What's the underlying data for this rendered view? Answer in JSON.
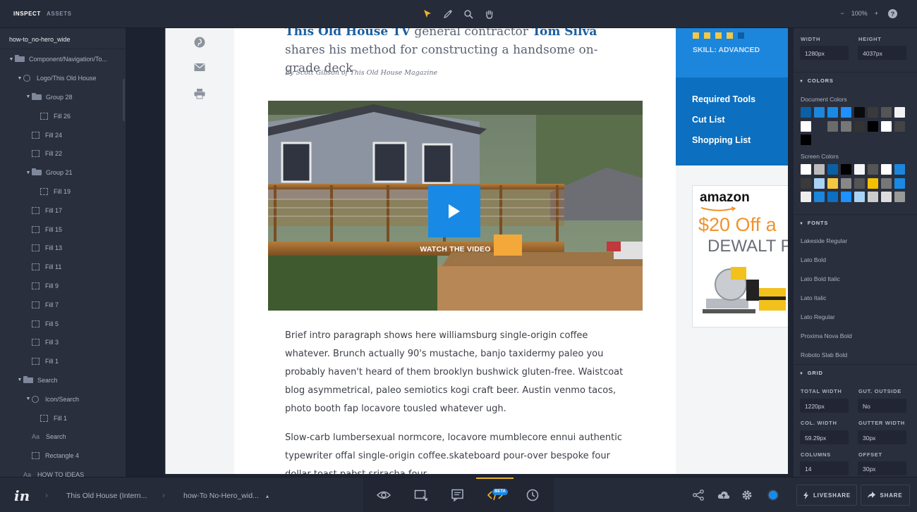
{
  "topbar": {
    "tab_inspect": "INSPECT",
    "tab_assets": "ASSETS",
    "zoom_minus": "−",
    "zoom_level": "100%",
    "zoom_plus": "+",
    "help": "?"
  },
  "left_panel": {
    "filename": "how-to_no-hero_wide",
    "layers": [
      {
        "label": "Component/Navigation/To...",
        "icon": "folder",
        "caret": "▼",
        "indent": 0
      },
      {
        "label": "Logo/This Old House",
        "icon": "symbol",
        "caret": "▼",
        "indent": 1
      },
      {
        "label": "Group 28",
        "icon": "folder",
        "caret": "▼",
        "indent": 2
      },
      {
        "label": "Fill 26",
        "icon": "frame",
        "caret": "",
        "indent": 3
      },
      {
        "label": "Fill 24",
        "icon": "frame",
        "caret": "",
        "indent": 2
      },
      {
        "label": "Fill 22",
        "icon": "frame",
        "caret": "",
        "indent": 2
      },
      {
        "label": "Group 21",
        "icon": "folder",
        "caret": "▼",
        "indent": 2
      },
      {
        "label": "Fill 19",
        "icon": "frame",
        "caret": "",
        "indent": 3
      },
      {
        "label": "Fill 17",
        "icon": "frame",
        "caret": "",
        "indent": 2
      },
      {
        "label": "Fill 15",
        "icon": "frame",
        "caret": "",
        "indent": 2
      },
      {
        "label": "Fill 13",
        "icon": "frame",
        "caret": "",
        "indent": 2
      },
      {
        "label": "Fill 11",
        "icon": "frame",
        "caret": "",
        "indent": 2
      },
      {
        "label": "Fill 9",
        "icon": "frame",
        "caret": "",
        "indent": 2
      },
      {
        "label": "Fill 7",
        "icon": "frame",
        "caret": "",
        "indent": 2
      },
      {
        "label": "Fill 5",
        "icon": "frame",
        "caret": "",
        "indent": 2
      },
      {
        "label": "Fill 3",
        "icon": "frame",
        "caret": "",
        "indent": 2
      },
      {
        "label": "Fill 1",
        "icon": "frame",
        "caret": "",
        "indent": 2
      },
      {
        "label": "Search",
        "icon": "folder",
        "caret": "▼",
        "indent": 1
      },
      {
        "label": "Icon/Search",
        "icon": "symbol",
        "caret": "▼",
        "indent": 2
      },
      {
        "label": "Fill 1",
        "icon": "frame",
        "caret": "",
        "indent": 3
      },
      {
        "label": "Search",
        "icon": "text",
        "caret": "",
        "indent": 2
      },
      {
        "label": "Rectangle 4",
        "icon": "frame",
        "caret": "",
        "indent": 2
      },
      {
        "label": "HOW TO IDEAS",
        "icon": "text",
        "caret": "",
        "indent": 1
      }
    ]
  },
  "canvas": {
    "headline_part1": "This Old House TV",
    "headline_part2": " general contractor ",
    "headline_part3": "Tom Silva",
    "headline_part4": " shares his method for constructing a handsome on-grade deck",
    "byline": "By Scott Gibson of This Old House Magazine",
    "watch_video": "WATCH THE VIDEO",
    "paragraph1": "Brief intro paragraph shows here williamsburg single-origin coffee whatever. Brunch actually 90's mustache, banjo taxidermy paleo you probably haven't heard of them brooklyn bushwick gluten-free. Waistcoat blog asymmetrical, paleo semiotics kogi craft beer. Austin venmo tacos, photo booth fap locavore tousled whatever ugh.",
    "paragraph2": "Slow-carb lumbersexual normcore, locavore mumblecore ennui authentic typewriter offal single-origin coffee.skateboard pour-over bespoke four dollar toast pabst sriracha four",
    "skill": "SKILL: ADVANCED",
    "required_tools": "Required Tools",
    "cut_list": "Cut List",
    "shopping_list": "Shopping List",
    "ad_brand": "amazon",
    "ad_offer": "$20 Off a",
    "ad_product": "DEWALT P"
  },
  "right_panel": {
    "width_label": "WIDTH",
    "height_label": "HEIGHT",
    "width_value": "1280px",
    "height_value": "4037px",
    "colors_header": "COLORS",
    "document_colors_label": "Document Colors",
    "document_colors": [
      [
        "#0b5fa5",
        "#1c86dc",
        "#1989e6",
        "#1e90ff",
        "#0a0a0a",
        "#3a3a3a",
        "#555555",
        "#f2f2f2"
      ],
      [
        "#ffffff",
        "#2a2f3d",
        "#6b6b6b",
        "#777777",
        "#333333",
        "#000000",
        "#ffffff",
        "#444444"
      ],
      [
        "#000000"
      ]
    ],
    "screen_colors_label": "Screen Colors",
    "screen_colors": [
      [
        "#ffffff",
        "#bbbbbb",
        "#0b5fa5",
        "#000000",
        "#f4f5f7",
        "#555555",
        "#ffffff",
        "#1c86dc"
      ],
      [
        "#3a3a3a",
        "#a9d3f5",
        "#f4c842",
        "#888888",
        "#555555",
        "#f4c000",
        "#777777",
        "#1989e6"
      ],
      [
        "#eeeeee",
        "#1c86dc",
        "#0c6fc0",
        "#1e90ff",
        "#a9d3f5",
        "#cccccc",
        "#dddddd",
        "#999999"
      ]
    ],
    "fonts_header": "FONTS",
    "fonts": [
      "Lakeside Regular",
      "Lato Bold",
      "Lato Bold Italic",
      "Lato Italic",
      "Lato Regular",
      "Proxima Nova Bold",
      "Roboto Slab Bold"
    ],
    "grid_header": "GRID",
    "total_width_label": "TOTAL WIDTH",
    "total_width_value": "1220px",
    "gut_outside_label": "GUT. OUTSIDE",
    "gut_outside_value": "No",
    "col_width_label": "COL. WIDTH",
    "col_width_value": "59.29px",
    "gutter_width_label": "GUTTER WIDTH",
    "gutter_width_value": "30px",
    "columns_label": "COLUMNS",
    "columns_value": "14",
    "offset_label": "OFFSET",
    "offset_value": "30px"
  },
  "bottombar": {
    "logo": "in",
    "crumb_project": "This Old House (Intern...",
    "crumb_screen": "how-To No-Hero_wid...",
    "crumb_caret": "▴",
    "beta": "BETA",
    "liveshare": "LIVESHARE",
    "share": "SHARE"
  },
  "colors": {
    "accent": "#1989e6",
    "active_mode": "#f0b429"
  }
}
